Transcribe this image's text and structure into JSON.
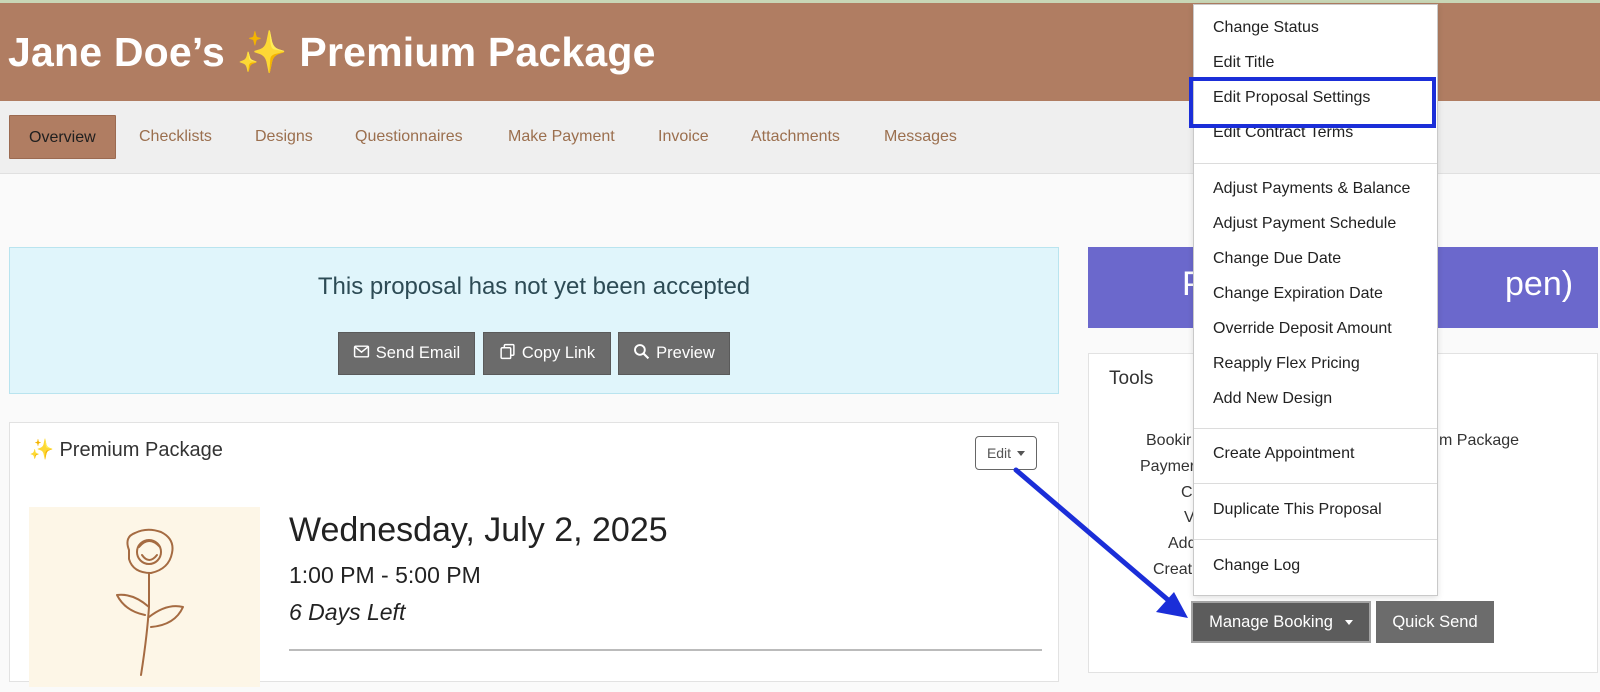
{
  "header": {
    "title": "Jane Doe’s ✨ Premium Package"
  },
  "tabs": [
    {
      "label": "Overview",
      "active": true
    },
    {
      "label": "Checklists"
    },
    {
      "label": "Designs"
    },
    {
      "label": "Questionnaires"
    },
    {
      "label": "Make Payment"
    },
    {
      "label": "Invoice"
    },
    {
      "label": "Attachments"
    },
    {
      "label": "Messages"
    }
  ],
  "alert": {
    "message": "This proposal has not yet been accepted",
    "buttons": {
      "send_email": "Send Email",
      "copy_link": "Copy Link",
      "preview": "Preview"
    }
  },
  "status_banner": {
    "text_visible_left": "P",
    "text_visible_right": "pen)"
  },
  "tools": {
    "heading": "Tools",
    "left_fragments": [
      "Bookir",
      "Paymer",
      "C",
      "V",
      "Add",
      "Creat"
    ],
    "right_fragment": "m Package"
  },
  "package": {
    "title": "✨ Premium Package",
    "edit_label": "Edit",
    "date": "Wednesday, July 2, 2025",
    "time": "1:00 PM - 5:00 PM",
    "days_left": "6 Days Left"
  },
  "manage_menu": {
    "groups": [
      [
        "Change Status",
        "Edit Title",
        "Edit Proposal Settings",
        "Edit Contract Terms"
      ],
      [
        "Adjust Payments & Balance",
        "Adjust Payment Schedule",
        "Change Due Date",
        "Change Expiration Date",
        "Override Deposit Amount",
        "Reapply Flex Pricing",
        "Add New Design"
      ],
      [
        "Create Appointment"
      ],
      [
        "Duplicate This Proposal"
      ],
      [
        "Change Log"
      ]
    ],
    "highlighted_item": "Edit Proposal Settings"
  },
  "actions": {
    "manage_booking": "Manage Booking",
    "quick_send": "Quick Send"
  },
  "colors": {
    "header_bg": "#b07d62",
    "alert_bg": "#e0f5fb",
    "banner_bg": "#6b68cc",
    "highlight": "#1b2ed8"
  }
}
